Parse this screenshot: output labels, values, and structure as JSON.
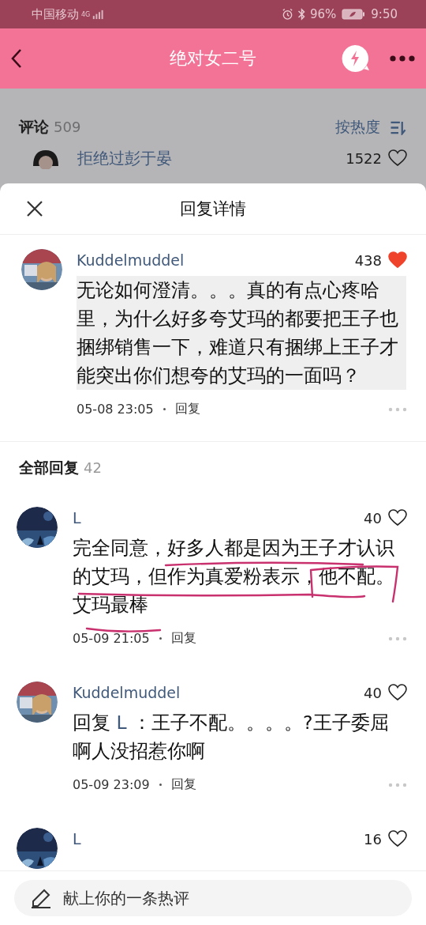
{
  "status_bar": {
    "carrier": "中国移动",
    "network": "4G",
    "battery": "96%",
    "time": "9:50"
  },
  "header": {
    "title": "绝对女二号"
  },
  "background": {
    "comments_label": "评论",
    "comments_count": "509",
    "sort": "按热度",
    "top_comment": {
      "user": "拒绝过彭于晏",
      "likes": "1522",
      "liked": false
    }
  },
  "sheet": {
    "title": "回复详情"
  },
  "main_comment": {
    "user": "Kuddelmuddel",
    "likes": "438",
    "liked": true,
    "highlighted": true,
    "text": "无论如何澄清。。。真的有点心疼哈里，为什么好多夸艾玛的都要把王子也捆绑销售一下，难道只有捆绑上王子才能突出你们想夸的艾玛的一面吗？",
    "time": "05-08 23:05",
    "reply_label": "回复"
  },
  "replies_header": {
    "label": "全部回复",
    "count": "42"
  },
  "replies": [
    {
      "user": "L",
      "likes": "40",
      "liked": false,
      "annotated": true,
      "text": "完全同意，好多人都是因为王子才认识的艾玛，但作为真爱粉表示，他不配。艾玛最棒",
      "time": "05-09 21:05",
      "reply_label": "回复"
    },
    {
      "user": "Kuddelmuddel",
      "likes": "40",
      "liked": false,
      "annotated": false,
      "prefix": "回复",
      "reply_to": "L",
      "text": "：王子不配。。。。?王子委屈啊人没招惹你啊",
      "time": "05-09 23:09",
      "reply_label": "回复"
    },
    {
      "user": "L",
      "likes": "16",
      "liked": false,
      "annotated": false
    }
  ],
  "composer": {
    "placeholder": "献上你的一条热评"
  }
}
